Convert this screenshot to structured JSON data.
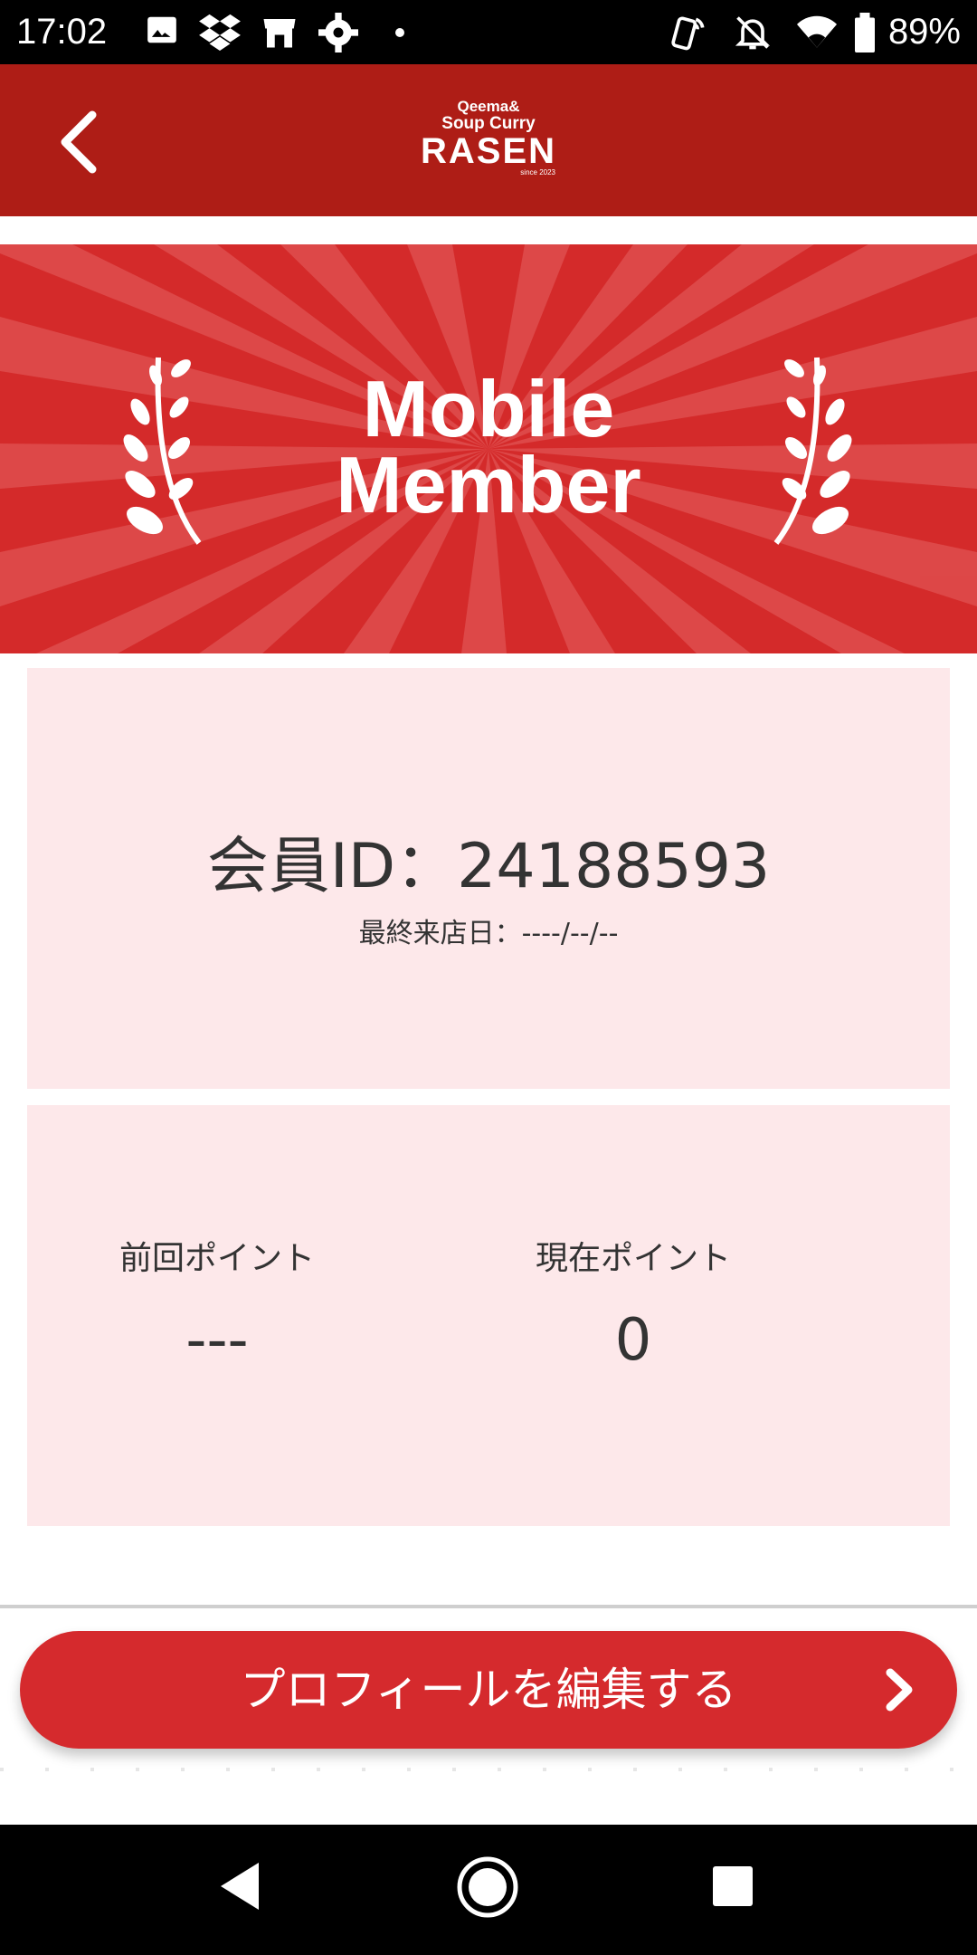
{
  "status_bar": {
    "time": "17:02",
    "battery_percent": "89%",
    "icons": [
      "image-icon",
      "dropbox-icon",
      "store-icon",
      "settings-gear-icon",
      "dot-icon",
      "nfc-phone-icon",
      "bell-off-icon",
      "wifi-icon",
      "battery-icon"
    ]
  },
  "header": {
    "back_icon": "chevron-left-icon",
    "logo": {
      "line1": "Qeema&",
      "line2": "Soup Curry",
      "line3": "RASEN",
      "line4": "since 2023"
    }
  },
  "hero": {
    "title_line1": "Mobile",
    "title_line2": "Member",
    "icons": [
      "laurel-left-icon",
      "laurel-right-icon"
    ]
  },
  "member_card": {
    "member_id": "会員ID：24188593",
    "last_visit": "最終来店日：----/--/--"
  },
  "points_card": {
    "previous_label": "前回ポイント",
    "previous_value": "---",
    "current_label": "現在ポイント",
    "current_value": "0"
  },
  "edit_profile_button": {
    "label": "プロフィールを編集する",
    "icon": "chevron-right-icon"
  },
  "colors": {
    "header": "#ae1d16",
    "hero": "#d42a2a",
    "card": "#fde8ea",
    "button": "#d52a2d"
  },
  "nav_bar": {
    "icons": [
      "back-triangle-icon",
      "home-circle-icon",
      "recents-square-icon"
    ]
  }
}
